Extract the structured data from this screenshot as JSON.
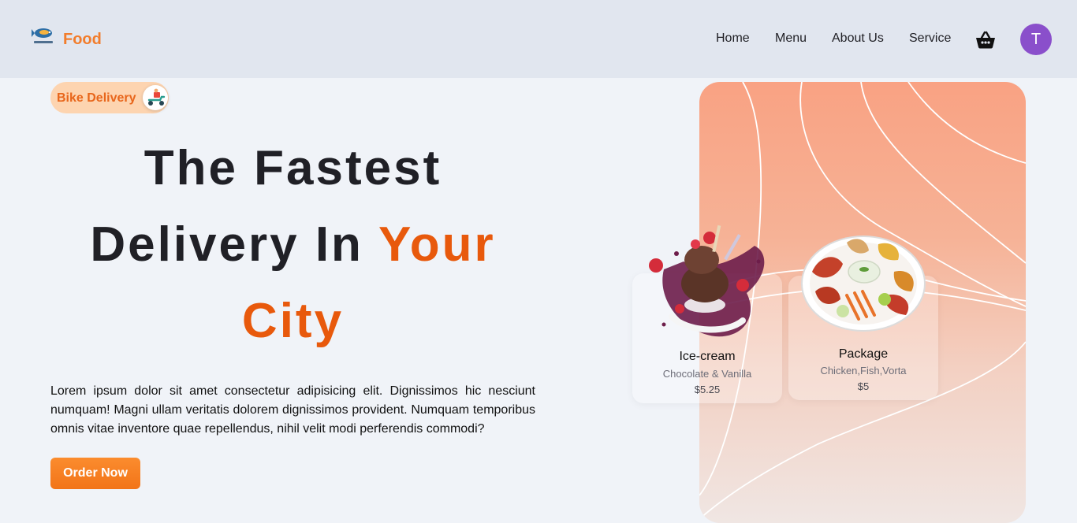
{
  "brand": {
    "name": "Food",
    "logo_icon": "fish-logo-icon"
  },
  "nav": {
    "items": [
      {
        "label": "Home"
      },
      {
        "label": "Menu"
      },
      {
        "label": "About Us"
      },
      {
        "label": "Service"
      }
    ],
    "cart_icon": "basket-icon",
    "avatar_initial": "T"
  },
  "hero": {
    "badge": {
      "label": "Bike Delivery",
      "icon": "scooter-icon"
    },
    "headline_line1": "The Fastest",
    "headline_line2_plain": "Delivery In",
    "headline_line2_accent": "Your",
    "headline_line3_accent": "City",
    "paragraph": "Lorem ipsum dolor sit amet consectetur adipisicing elit. Dignissimos hic nesciunt numquam! Magni ullam veritatis dolorem dignissimos provident. Numquam temporibus omnis vitae inventore quae repellendus, nihil velit modi perferendis commodi?",
    "cta_label": "Order Now"
  },
  "cards": [
    {
      "name": "Ice-cream",
      "description": "Chocolate & Vanilla",
      "price": "$5.25",
      "image_icon": "ice-cream-icon"
    },
    {
      "name": "Package",
      "description": "Chicken,Fish,Vorta",
      "price": "$5",
      "image_icon": "platter-icon"
    }
  ],
  "colors": {
    "accent": "#e8590c",
    "brand": "#f27d2c",
    "header_bg": "#e1e6ef",
    "page_bg": "#f0f3f8",
    "avatar_bg": "#8a4fcb",
    "panel_top": "#f9a283"
  }
}
